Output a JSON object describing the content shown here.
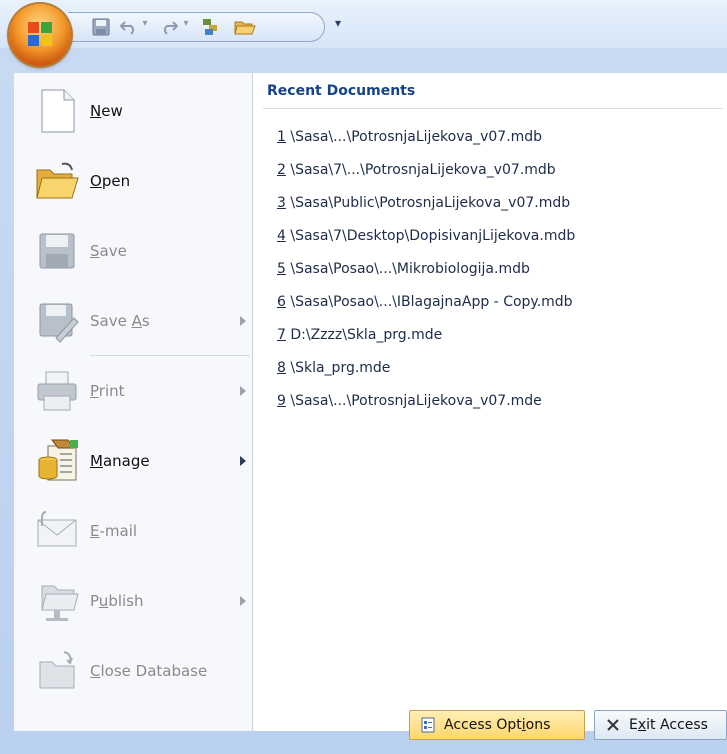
{
  "quick_access": {
    "customize_glyph": "▾",
    "separator_glyph": "▾",
    "icons": [
      "save-icon",
      "undo-icon",
      "redo-icon",
      "sort-icon",
      "open-folder-icon"
    ]
  },
  "menu": {
    "commands": [
      {
        "id": "new",
        "label": "New",
        "mnemonic": "N",
        "rest": "ew",
        "enabled": true,
        "submenu": false,
        "icon": "new-document-icon"
      },
      {
        "id": "open",
        "label": "Open",
        "mnemonic": "O",
        "rest": "pen",
        "enabled": true,
        "submenu": false,
        "icon": "open-folder-icon"
      },
      {
        "id": "save",
        "label": "Save",
        "mnemonic": "S",
        "rest": "ave",
        "enabled": false,
        "submenu": false,
        "icon": "save-disk-icon"
      },
      {
        "id": "saveas",
        "label": "Save As",
        "pre": "Save ",
        "mnemonic": "A",
        "rest": "s",
        "enabled": false,
        "submenu": true,
        "icon": "save-as-icon"
      },
      {
        "id": "print",
        "label": "Print",
        "mnemonic": "P",
        "rest": "rint",
        "enabled": false,
        "submenu": true,
        "icon": "printer-icon"
      },
      {
        "id": "manage",
        "label": "Manage",
        "mnemonic": "M",
        "rest": "anage",
        "enabled": true,
        "submenu": true,
        "icon": "manage-database-icon"
      },
      {
        "id": "email",
        "label": "E-mail",
        "mnemonic": "E",
        "rest": "-mail",
        "enabled": false,
        "submenu": false,
        "icon": "email-icon"
      },
      {
        "id": "publish",
        "label": "Publish",
        "pre": "P",
        "mnemonic": "u",
        "rest": "blish",
        "enabled": false,
        "submenu": true,
        "icon": "publish-icon"
      },
      {
        "id": "close",
        "label": "Close Database",
        "mnemonic": "C",
        "rest": "lose Database",
        "enabled": false,
        "submenu": false,
        "icon": "close-database-icon"
      }
    ]
  },
  "recent": {
    "title": "Recent Documents",
    "items": [
      {
        "num": "1",
        "path": " \\Sasa\\...\\PotrosnjaLijekova_v07.mdb"
      },
      {
        "num": "2",
        "path": " \\Sasa\\7\\...\\PotrosnjaLijekova_v07.mdb"
      },
      {
        "num": "3",
        "path": " \\Sasa\\Public\\PotrosnjaLijekova_v07.mdb"
      },
      {
        "num": "4",
        "path": " \\Sasa\\7\\Desktop\\DopisivanjLijekova.mdb"
      },
      {
        "num": "5",
        "path": " \\Sasa\\Posao\\...\\Mikrobiologija.mdb"
      },
      {
        "num": "6",
        "path": " \\Sasa\\Posao\\...\\IBlagajnaApp - Copy.mdb"
      },
      {
        "num": "7",
        "path": " D:\\Zzzz\\Skla_prg.mde"
      },
      {
        "num": "8",
        "path": " \\Skla_prg.mde"
      },
      {
        "num": "9",
        "path": " \\Sasa\\...\\PotrosnjaLijekova_v07.mde"
      }
    ]
  },
  "footer": {
    "options_pre": "Access Opt",
    "options_mnemonic": "i",
    "options_post": "ons",
    "exit_pre": "E",
    "exit_mnemonic": "x",
    "exit_post": "it Access"
  }
}
